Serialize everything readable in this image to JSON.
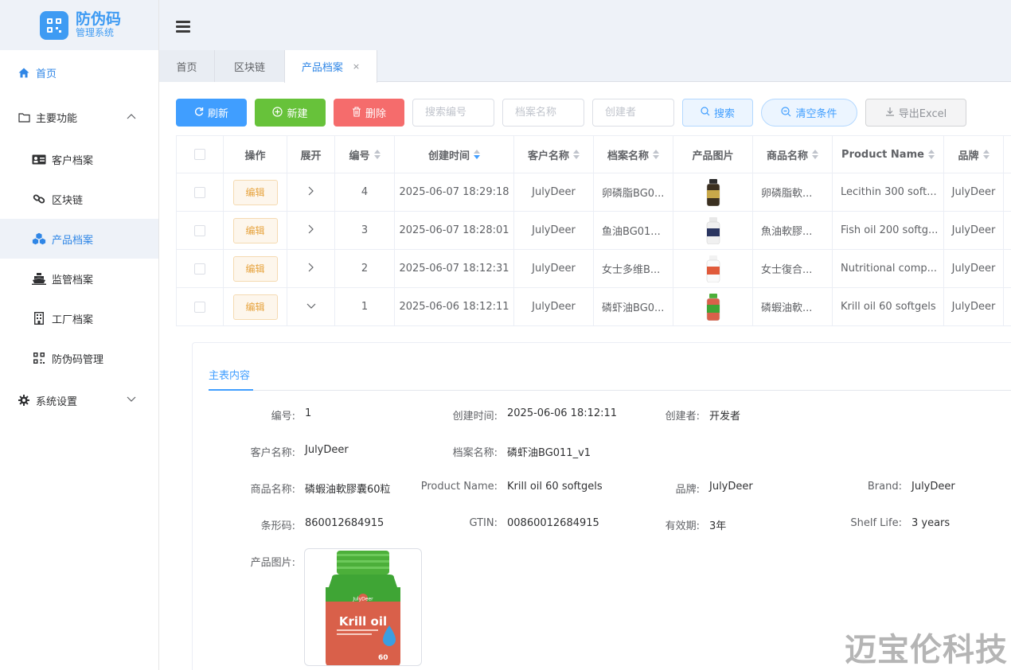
{
  "app": {
    "title": "防伪码",
    "subtitle": "管理系统"
  },
  "sidebar": {
    "home": "首页",
    "main_group": "主要功能",
    "items": [
      "客户档案",
      "区块链",
      "产品档案",
      "监管档案",
      "工厂档案",
      "防伪码管理"
    ],
    "settings": "系统设置"
  },
  "tabs": [
    {
      "label": "首页"
    },
    {
      "label": "区块链"
    },
    {
      "label": "产品档案",
      "close": "×"
    }
  ],
  "toolbar": {
    "refresh": "刷新",
    "new": "新建",
    "delete": "删除",
    "ph_number": "搜索编号",
    "ph_archive": "档案名称",
    "ph_creator": "创建者",
    "search": "搜索",
    "clear": "清空条件",
    "export": "导出Excel"
  },
  "table": {
    "headers": [
      "操作",
      "展开",
      "编号",
      "创建时间",
      "客户名称",
      "档案名称",
      "产品图片",
      "商品名称",
      "Product Name",
      "品牌"
    ],
    "edit_label": "编辑",
    "rows": [
      {
        "id": "4",
        "created": "2025-06-07 18:29:18",
        "customer": "JulyDeer",
        "archive": "卵磷脂BG0...",
        "goods": "卵磷脂軟...",
        "product": "Lecithin 300 soft...",
        "brand": "JulyDeer",
        "expanded": false
      },
      {
        "id": "3",
        "created": "2025-06-07 18:28:01",
        "customer": "JulyDeer",
        "archive": "鱼油BG01...",
        "goods": "魚油軟膠...",
        "product": "Fish oil 200 softg...",
        "brand": "JulyDeer",
        "expanded": false
      },
      {
        "id": "2",
        "created": "2025-06-07 18:12:31",
        "customer": "JulyDeer",
        "archive": "女士多维B...",
        "goods": "女士復合...",
        "product": "Nutritional comp...",
        "brand": "JulyDeer",
        "expanded": false
      },
      {
        "id": "1",
        "created": "2025-06-06 18:12:11",
        "customer": "JulyDeer",
        "archive": "磷虾油BG0...",
        "goods": "磷蝦油軟...",
        "product": "Krill oil 60 softgels",
        "brand": "JulyDeer",
        "expanded": true
      }
    ]
  },
  "detail": {
    "tab": "主表内容",
    "l_number": "编号:",
    "v_number": "1",
    "l_created": "创建时间:",
    "v_created": "2025-06-06 18:12:11",
    "l_creator": "创建者:",
    "v_creator": "开发者",
    "l_customer": "客户名称:",
    "v_customer": "JulyDeer",
    "l_archive": "档案名称:",
    "v_archive": "磷虾油BG011_v1",
    "l_goods": "商品名称:",
    "v_goods": "磷蝦油軟膠囊60粒",
    "l_product": "Product Name:",
    "v_product": "Krill oil 60 softgels",
    "l_brand_cn": "品牌:",
    "v_brand_cn": "JulyDeer",
    "l_brand_en": "Brand:",
    "v_brand_en": "JulyDeer",
    "l_barcode": "条形码:",
    "v_barcode": "860012684915",
    "l_gtin": "GTIN:",
    "v_gtin": "00860012684915",
    "l_validity": "有效期:",
    "v_validity": "3年",
    "l_shelf": "Shelf Life:",
    "v_shelf": "3 years",
    "l_image": "产品图片:",
    "image_brand": "JulyDeer",
    "image_title": "Krill oil",
    "image_count": "60"
  },
  "watermark": "迈宝伦科技"
}
